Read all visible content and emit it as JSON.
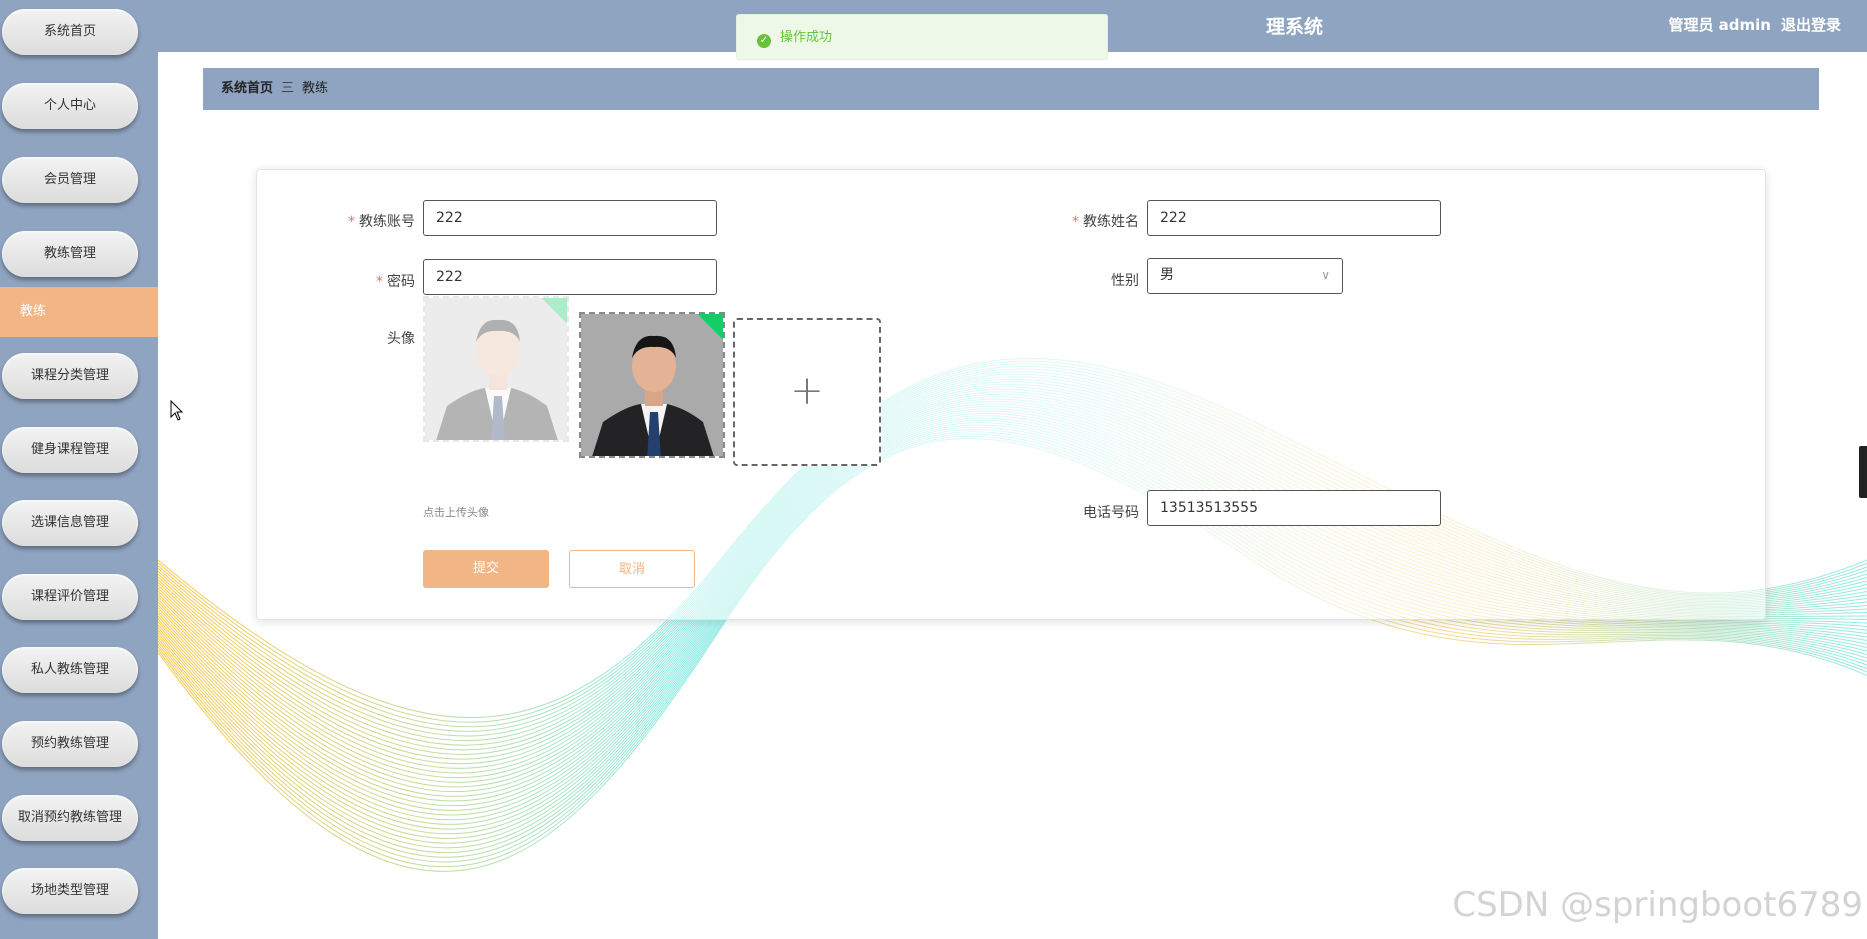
{
  "header": {
    "title_fragment": "理系统",
    "user_role": "管理员 admin",
    "logout_label": "退出登录"
  },
  "toast": {
    "message": "操作成功"
  },
  "sidebar": {
    "items": [
      {
        "label": "系统首页"
      },
      {
        "label": "个人中心"
      },
      {
        "label": "会员管理"
      },
      {
        "label": "教练管理"
      },
      {
        "label": "课程分类管理"
      },
      {
        "label": "健身课程管理"
      },
      {
        "label": "选课信息管理"
      },
      {
        "label": "课程评价管理"
      },
      {
        "label": "私人教练管理"
      },
      {
        "label": "预约教练管理"
      },
      {
        "label": "取消预约教练管理"
      },
      {
        "label": "场地类型管理"
      }
    ],
    "active_sub": "教练"
  },
  "breadcrumb": {
    "home": "系统首页",
    "separator": "三",
    "current": "教练"
  },
  "form": {
    "account": {
      "label": "教练账号",
      "value": "222"
    },
    "name": {
      "label": "教练姓名",
      "value": "222"
    },
    "password": {
      "label": "密码",
      "value": "222"
    },
    "gender": {
      "label": "性别",
      "value": "男"
    },
    "avatar": {
      "label": "头像",
      "hint": "点击上传头像"
    },
    "phone": {
      "label": "电话号码",
      "value": "13513513555"
    },
    "submit_label": "提交",
    "cancel_label": "取消"
  },
  "watermark": "CSDN @springboot6789",
  "colors": {
    "sidebar": "#8fa4c1",
    "accent": "#f2b585",
    "success": "#67c23a"
  },
  "icons": [
    "success-check-icon",
    "upload-plus-icon",
    "dropdown-arrow-icon",
    "mouse-cursor-icon"
  ]
}
